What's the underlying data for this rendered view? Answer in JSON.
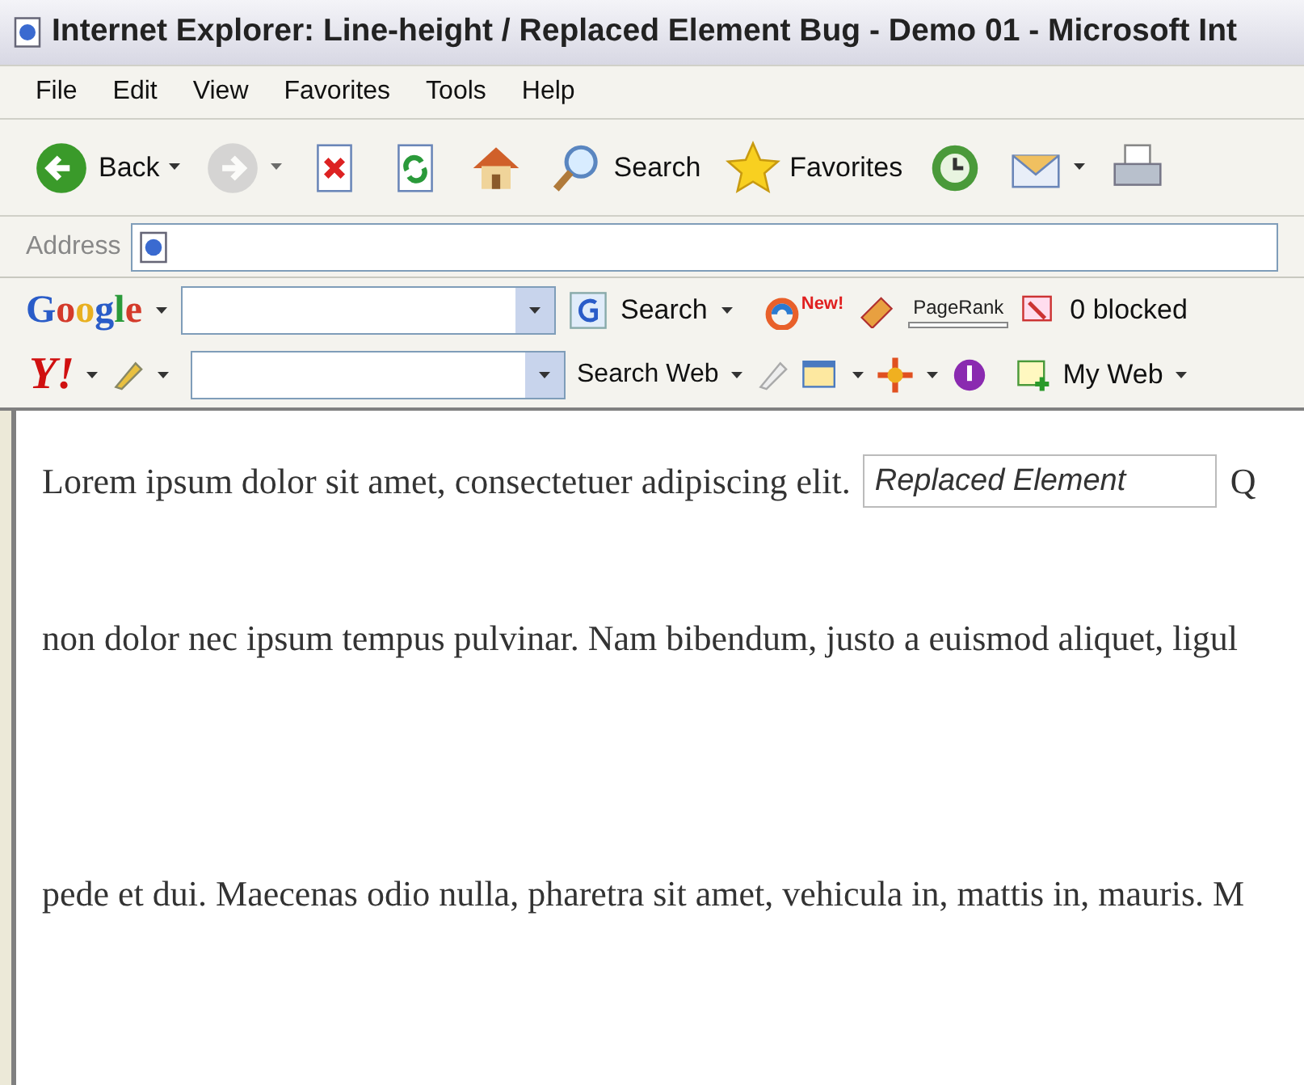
{
  "window": {
    "title": "Internet Explorer: Line-height / Replaced Element Bug - Demo 01 - Microsoft Int"
  },
  "menu": [
    "File",
    "Edit",
    "View",
    "Favorites",
    "Tools",
    "Help"
  ],
  "toolbar": [
    {
      "kind": "back",
      "label": "Back",
      "dropdown": true,
      "disabled": false
    },
    {
      "kind": "forward",
      "dropdown": true,
      "disabled": true
    },
    {
      "kind": "stop",
      "dropdown": false,
      "disabled": false
    },
    {
      "kind": "refresh",
      "dropdown": false,
      "disabled": false
    },
    {
      "kind": "home",
      "dropdown": false,
      "disabled": false
    },
    {
      "kind": "search",
      "label": "Search",
      "dropdown": false,
      "disabled": false
    },
    {
      "kind": "favorites",
      "label": "Favorites",
      "dropdown": false,
      "disabled": false
    },
    {
      "kind": "history",
      "dropdown": false,
      "disabled": false
    },
    {
      "kind": "mail",
      "dropdown": true,
      "disabled": false
    },
    {
      "kind": "print",
      "dropdown": false,
      "disabled": false
    }
  ],
  "address": {
    "label": "Address"
  },
  "google_bar": {
    "logo": "Google",
    "search_label": "Search",
    "new_badge": "New!",
    "pagerank": "PageRank",
    "blocked": "0 blocked"
  },
  "yahoo_bar": {
    "logo": "Y!",
    "search_label": "Search Web",
    "my_web": "My Web"
  },
  "content": {
    "line_1": "Lorem ipsum dolor sit amet, consectetuer adipiscing elit.",
    "replaced_element": "Replaced Element",
    "line_1_end": "Q",
    "line_2": "non dolor nec ipsum tempus pulvinar. Nam bibendum, justo a euismod aliquet, ligul",
    "line_3": "pede et dui. Maecenas odio nulla, pharetra sit amet, vehicula in, mattis in, mauris. M"
  }
}
